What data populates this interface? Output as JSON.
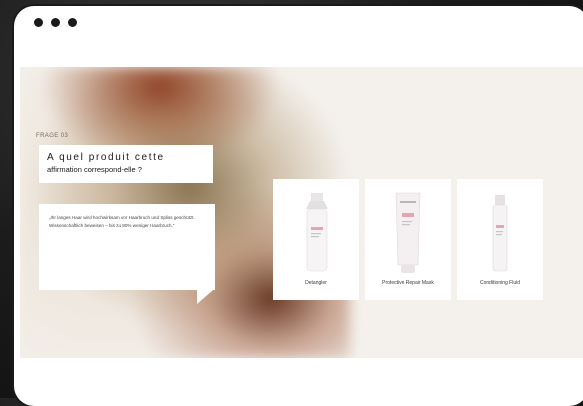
{
  "window": {
    "controls": [
      "close",
      "minimize",
      "maximize"
    ]
  },
  "quiz": {
    "question_label": "FRAGE 03",
    "question_line1": "A quel produit cette",
    "question_line2": "affirmation correspond-elle ?",
    "quote": "„Ihr langes Haar wird hochwirksam vor Haarbruch und Spliss geschützt. Wissenschaftlich beweisen – bis zu 80% weniger Haarbruch.“"
  },
  "products": [
    {
      "name": "Detangler",
      "color": "#ffffff"
    },
    {
      "name": "Protective Repair Mask",
      "color": "#f2eef0"
    },
    {
      "name": "Conditioning Fluid",
      "color": "#f4f1f2"
    }
  ],
  "colors": {
    "accent_pink": "#e8a3b5",
    "background": "#f4f1ec"
  }
}
